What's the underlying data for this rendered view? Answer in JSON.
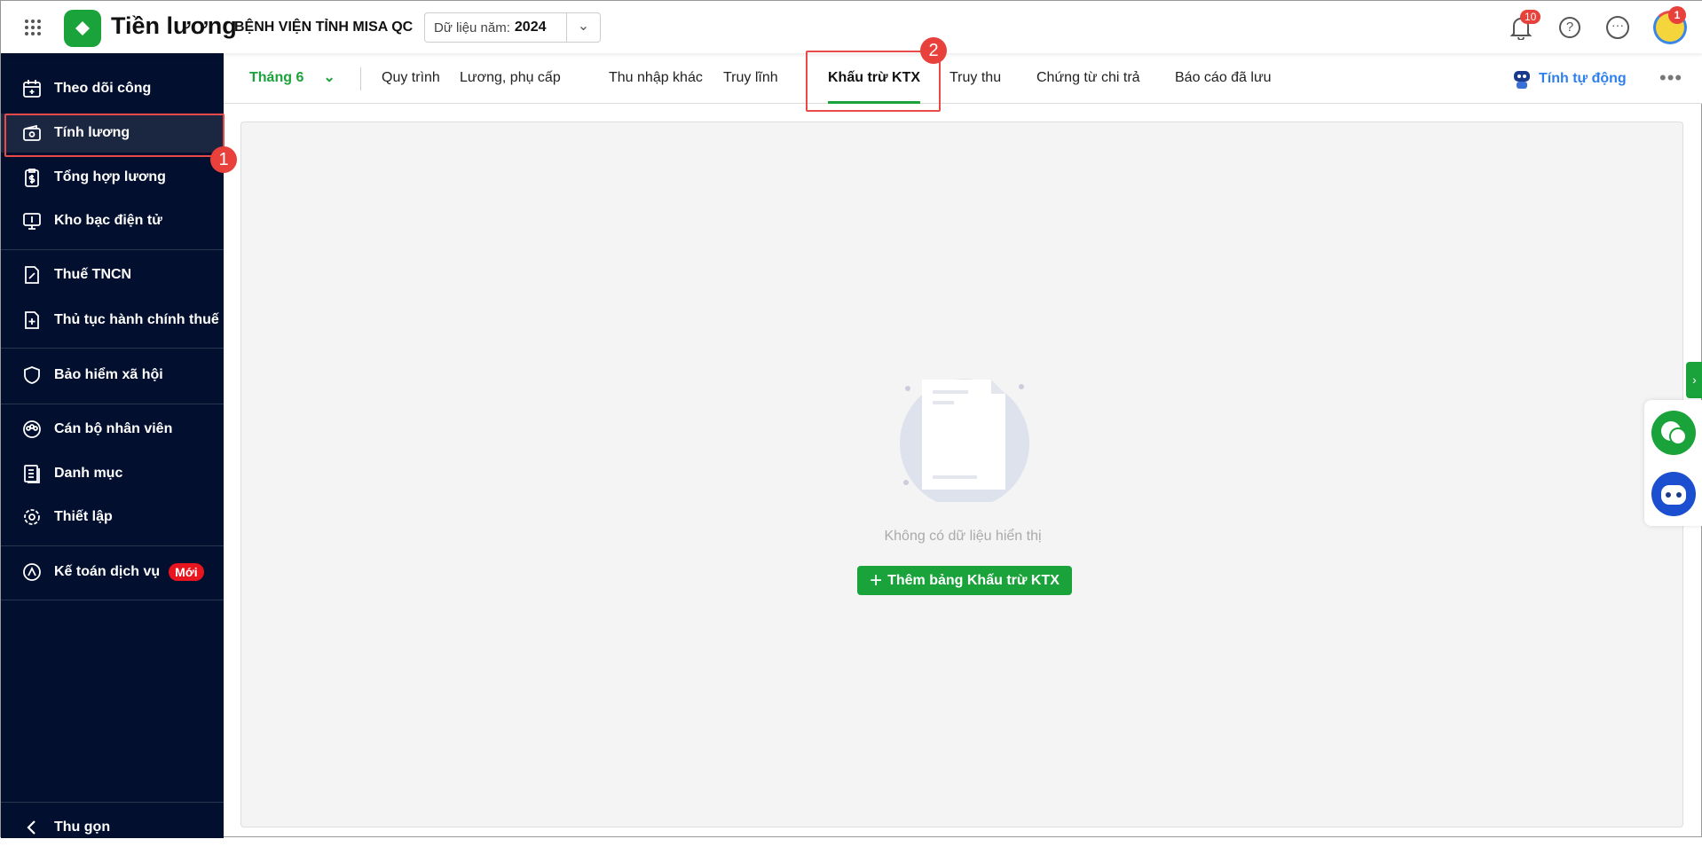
{
  "header": {
    "app_name": "Tiền lương",
    "org_name": "BỆNH VIỆN TỈNH MISA QC",
    "year_label": "Dữ liệu năm:",
    "year_value": "2024",
    "notification_count": "10",
    "avatar_badge": "1"
  },
  "sidebar": {
    "items": [
      {
        "label": "Theo dõi công"
      },
      {
        "label": "Tính lương"
      },
      {
        "label": "Tổng hợp lương"
      },
      {
        "label": "Kho bạc điện tử"
      },
      {
        "label": "Thuế TNCN"
      },
      {
        "label": "Thủ tục hành chính thuế"
      },
      {
        "label": "Bảo hiểm xã hội"
      },
      {
        "label": "Cán bộ nhân viên"
      },
      {
        "label": "Danh mục"
      },
      {
        "label": "Thiết lập"
      },
      {
        "label": "Kế toán dịch vụ",
        "badge": "Mới"
      }
    ],
    "collapse_label": "Thu gọn"
  },
  "tabbar": {
    "month": "Tháng 6",
    "tabs": [
      "Quy trình",
      "Lương, phụ cấp",
      "Thu nhập khác",
      "Truy lĩnh",
      "Khấu trừ KTX",
      "Truy thu",
      "Chứng từ chi trả",
      "Báo cáo đã lưu"
    ],
    "active_tab": "Khấu trừ KTX",
    "auto_calc": "Tính tự động"
  },
  "main": {
    "empty_text": "Không có dữ liệu hiển thị",
    "add_button": "Thêm bảng Khấu trừ KTX"
  },
  "annotations": {
    "step1": "1",
    "step2": "2"
  },
  "colors": {
    "accent": "#1aa33a",
    "sidebar_bg": "#020f2e",
    "highlight": "#e84a4a",
    "link": "#2f80ed"
  }
}
